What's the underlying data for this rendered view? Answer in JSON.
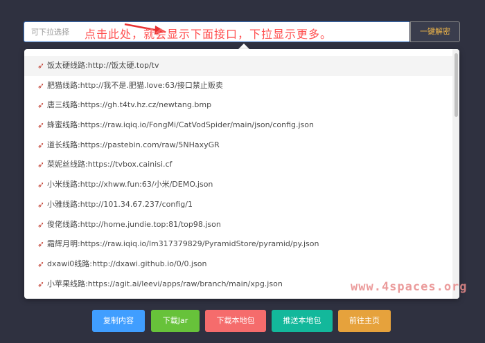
{
  "search": {
    "placeholder": "可下拉选择",
    "decode_label": "一键解密"
  },
  "annotation": {
    "text": "点击此处，就会显示下面接口，下拉显示更多。",
    "color": "#ff4f4f"
  },
  "dropdown": {
    "icon": "rocket-icon",
    "items": [
      "饭太硬线路:http://饭太硬.top/tv",
      "肥猫线路:http://我不是.肥猫.love:63/接口禁止贩卖",
      "唐三线路:https://gh.t4tv.hz.cz/newtang.bmp",
      "蜂蜜线路:https://raw.iqiq.io/FongMi/CatVodSpider/main/json/config.json",
      "道长线路:https://pastebin.com/raw/5NHaxyGR",
      "菜妮丝线路:https://tvbox.cainisi.cf",
      "小米线路:http://xhww.fun:63/小米/DEMO.json",
      "小雅线路:http://101.34.67.237/config/1",
      "俊佬线路:http://home.jundie.top:81/top98.json",
      "霜辉月明:https://raw.iqiq.io/lm317379829/PyramidStore/pyramid/py.json",
      "dxawi0线路:http://dxawi.github.io/0/0.json",
      "小苹果线路:https://agit.ai/leevi/apps/raw/branch/main/xpg.json"
    ]
  },
  "watermark": "www.4spaces.org",
  "buttons": {
    "copy": {
      "label": "复制内容",
      "color": "#409eff"
    },
    "download_jar": {
      "label": "下载Jar",
      "color": "#67c23a"
    },
    "download_local": {
      "label": "下载本地包",
      "color": "#f56c6c"
    },
    "push_local": {
      "label": "推送本地包",
      "color": "#13b89b"
    },
    "home": {
      "label": "前往主页",
      "color": "#e6a23c"
    }
  }
}
